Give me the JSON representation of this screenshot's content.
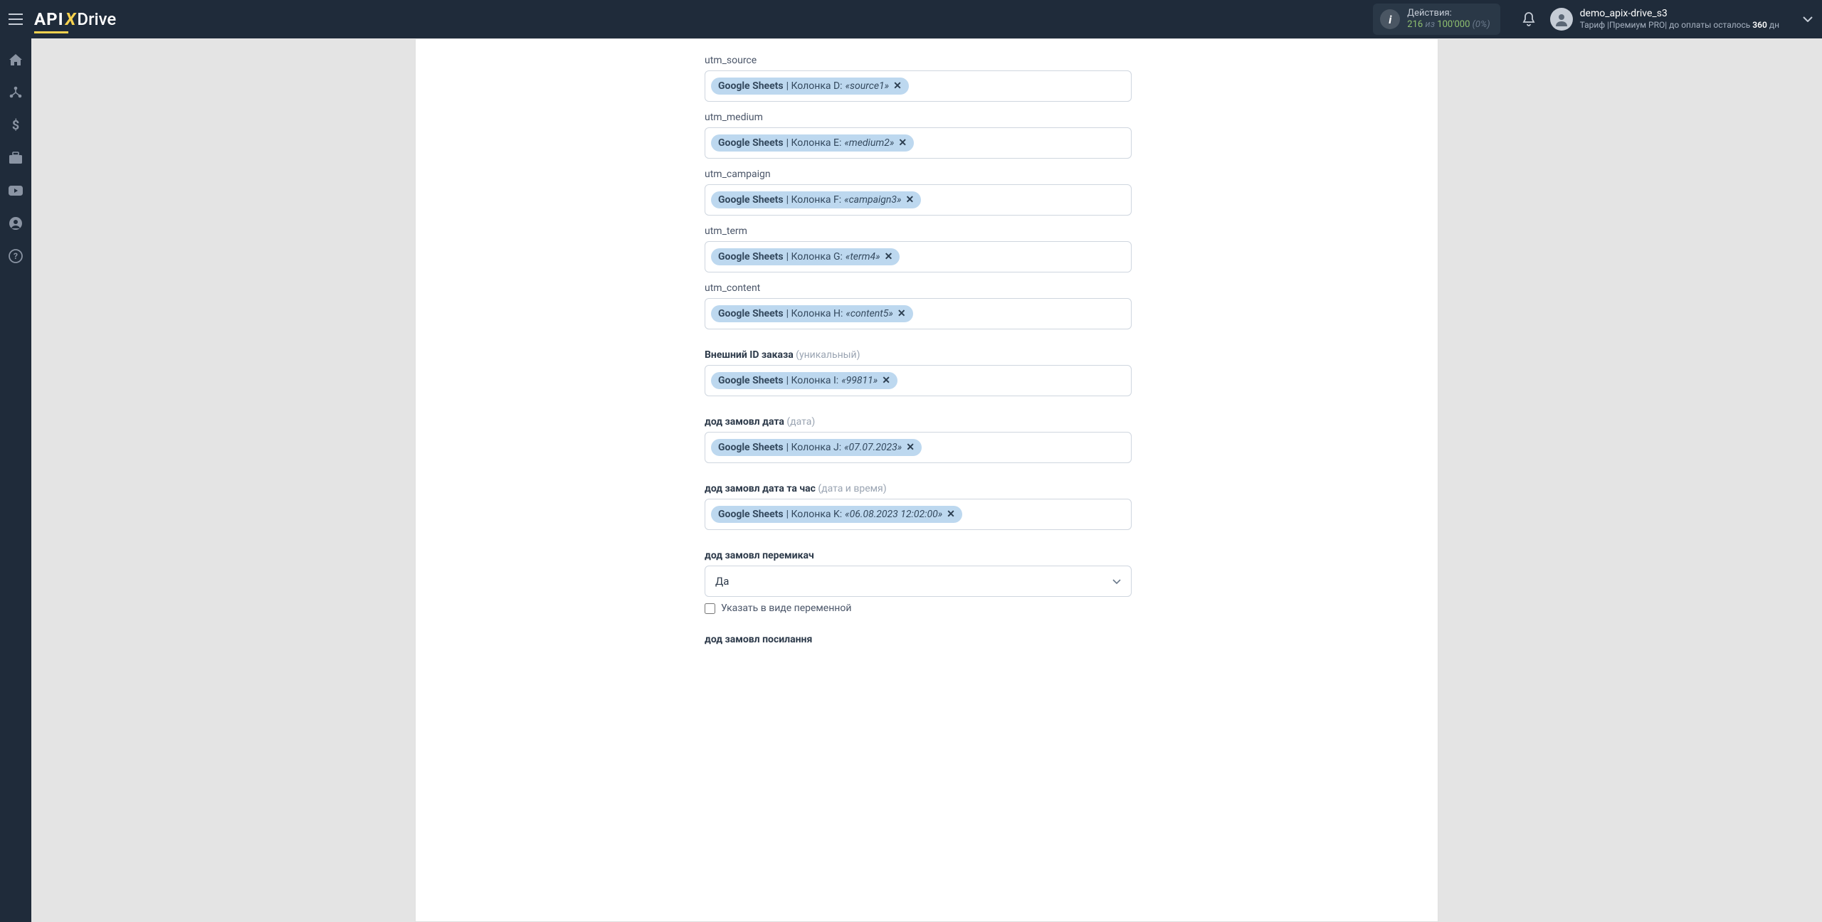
{
  "header": {
    "logo_api": "API",
    "logo_x": "X",
    "logo_drive": "Drive",
    "actions_label": "Действия:",
    "actions_used": "216",
    "actions_sep": " из ",
    "actions_total": "100'000",
    "actions_pct": " (0%)",
    "user_name": "demo_apix-drive_s3",
    "user_tariff_prefix": "Тариф |",
    "user_tariff_name": "Премиум PRO",
    "user_tariff_sep": "| до оплаты осталось ",
    "user_days": "360",
    "user_days_suffix": " дн"
  },
  "fields": [
    {
      "label": "utm_source",
      "strong": false,
      "hint": "",
      "tag": {
        "src": "Google Sheets",
        "col": " | Колонка D: ",
        "val": "«source1»"
      }
    },
    {
      "label": "utm_medium",
      "strong": false,
      "hint": "",
      "tag": {
        "src": "Google Sheets",
        "col": " | Колонка E: ",
        "val": "«medium2»"
      }
    },
    {
      "label": "utm_campaign",
      "strong": false,
      "hint": "",
      "tag": {
        "src": "Google Sheets",
        "col": " | Колонка F: ",
        "val": "«campaign3»"
      }
    },
    {
      "label": "utm_term",
      "strong": false,
      "hint": "",
      "tag": {
        "src": "Google Sheets",
        "col": " | Колонка G: ",
        "val": "«term4»"
      }
    },
    {
      "label": "utm_content",
      "strong": false,
      "hint": "",
      "tag": {
        "src": "Google Sheets",
        "col": " | Колонка H: ",
        "val": "«content5»"
      }
    },
    {
      "label": "Внешний ID заказа",
      "strong": true,
      "hint": " (уникальный)",
      "tag": {
        "src": "Google Sheets",
        "col": " | Колонка I: ",
        "val": "«99811»"
      }
    },
    {
      "label": "дод замовл дата",
      "strong": true,
      "hint": " (дата)",
      "tag": {
        "src": "Google Sheets",
        "col": " | Колонка J: ",
        "val": "«07.07.2023»"
      }
    },
    {
      "label": "дод замовл дата та час",
      "strong": true,
      "hint": " (дата и время)",
      "tag": {
        "src": "Google Sheets",
        "col": " | Колонка K: ",
        "val": "«06.08.2023 12:02:00»"
      }
    }
  ],
  "select_field": {
    "label": "дод замовл перемикач",
    "value": "Да",
    "checkbox_label": "Указать в виде переменной"
  },
  "last_label": "дод замовл посилання"
}
